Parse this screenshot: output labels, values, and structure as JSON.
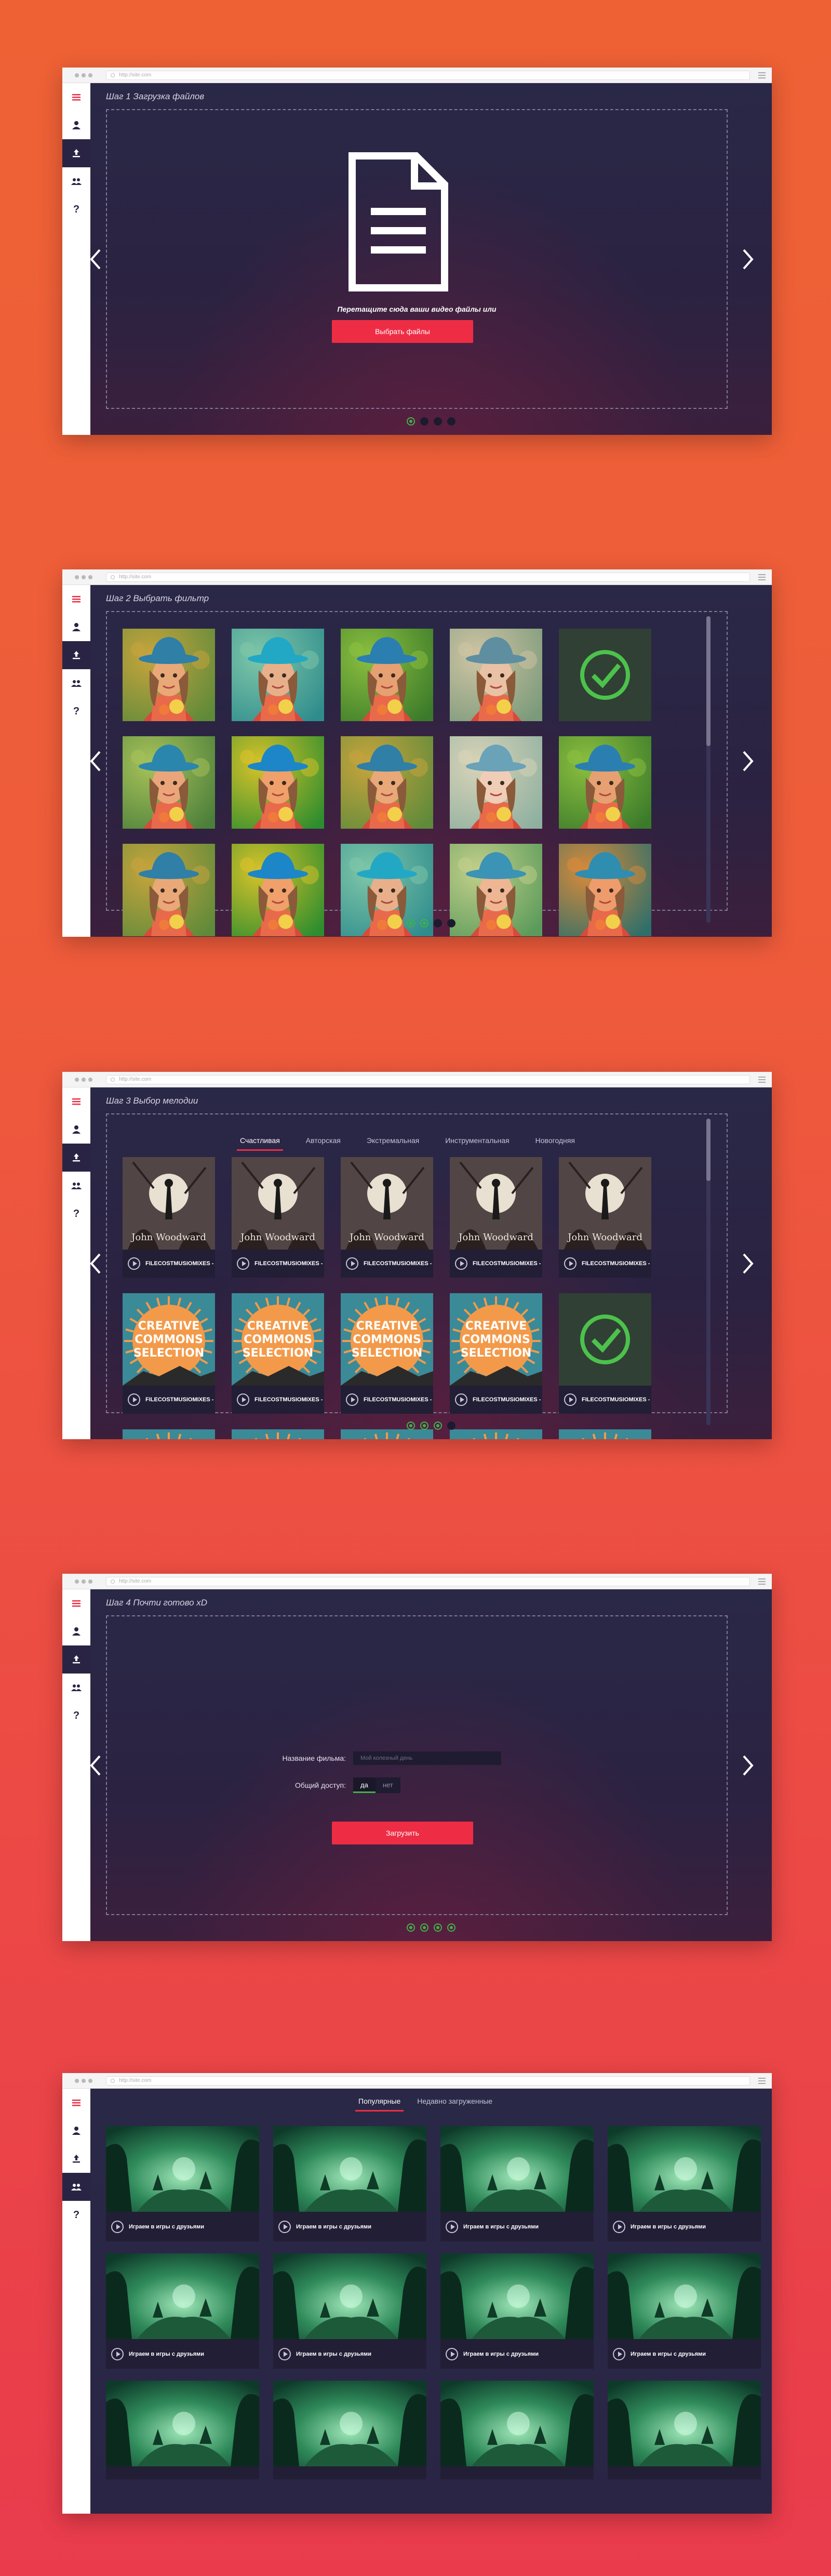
{
  "url": "http://site.com",
  "sidebar_icons": [
    "menu-icon",
    "user-icon",
    "upload-icon",
    "group-icon",
    "help-icon"
  ],
  "help_glyph": "?",
  "step1": {
    "title": "Шаг 1 Загрузка файлов",
    "drop_text": "Перетащите сюда ваши видео файлы или",
    "button": "Выбрать файлы",
    "pager": [
      true,
      false,
      false,
      false
    ]
  },
  "step2": {
    "title": "Шаг 2 Выбрать фильтр",
    "pager": [
      true,
      true,
      false,
      false
    ],
    "filters": [
      "warm",
      "teal",
      "green",
      "fade",
      "selected",
      "natural",
      "vivid",
      "warm",
      "pale",
      "green",
      "warm",
      "vivid",
      "teal",
      "soft",
      "sunset"
    ]
  },
  "step3": {
    "title": "Шаг 3 Выбор мелодии",
    "tabs": [
      "Счастливая",
      "Авторская",
      "Экстремальная",
      "Инструментальная",
      "Новогодняя"
    ],
    "active_tab": 0,
    "pager": [
      true,
      true,
      true,
      false
    ],
    "row1_cover": {
      "artist": "John Woodward",
      "label": "FILECOSTMUSIOMIXES - TWAMX"
    },
    "row2_cover": {
      "lines": [
        "CREATIVE",
        "COMMONS",
        "SELECTION"
      ],
      "label": "FILECOSTMUSIOMIXES - DEAF"
    }
  },
  "step4": {
    "title": "Шаг 4 Почти готово xD",
    "film_name_label": "Название фильма:",
    "film_name_placeholder": "Мой колезный день",
    "access_label": "Общий доступ:",
    "yes": "да",
    "no": "нет",
    "button": "Загрузить",
    "pager": [
      true,
      true,
      true,
      true
    ]
  },
  "gallery": {
    "tabs": [
      "Популярные",
      "Недавно загруженные"
    ],
    "active_tab": 0,
    "item_label": "Играем в игры с друзьями"
  },
  "colors": {
    "accent_red": "#ee2d45",
    "success_green": "#3fb24a",
    "panel": "#2a2444"
  }
}
